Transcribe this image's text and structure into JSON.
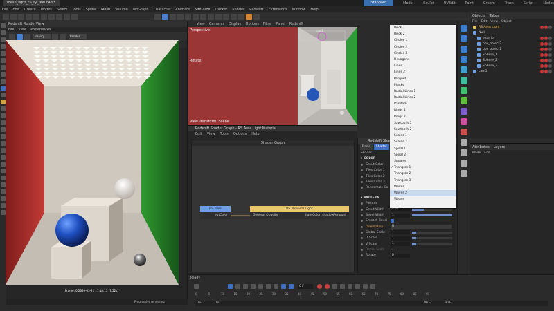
{
  "titlebar": {
    "tab": "mesh_light_cu_ty_real.c4d *",
    "layouts": [
      "Standard",
      "Model",
      "Sculpt",
      "UVEdit",
      "Paint",
      "Groom",
      "Track",
      "Script",
      "Nodes"
    ]
  },
  "menu": [
    "File",
    "Edit",
    "Create",
    "Modes",
    "Select",
    "Tools",
    "Spline",
    "Mesh",
    "Volume",
    "MoGraph",
    "Character",
    "Animate",
    "Simulate",
    "Tracker",
    "Render",
    "Redshift",
    "Extensions",
    "Window",
    "Help"
  ],
  "renderview": {
    "title": "Redshift RenderView",
    "menu": [
      "File",
      "View",
      "Preferences"
    ],
    "mode": "Beauty",
    "render_sel": "Render",
    "zoom": "96 %",
    "size": "Original Size",
    "frame_info": "Frame: 0  2020-03-21  17:18:13  (7.52s)",
    "status": "Progressive rendering"
  },
  "viewport": {
    "menu": [
      "View",
      "Cameras",
      "Display",
      "Options",
      "Filter",
      "Panel",
      "Redshift"
    ],
    "label": "Perspective",
    "mode": "Rotate",
    "bottom": "View Transform: Scene",
    "camera": "cam1"
  },
  "shader": {
    "title": "Redshift Shader Graph - RS Area Light Material",
    "menu": [
      "Edit",
      "View",
      "Tools",
      "Options",
      "Help"
    ],
    "graph_title": "Shader Graph",
    "node1": {
      "title": "RS Tiles",
      "port": "outColor"
    },
    "node2": {
      "title": "RS Physical Light",
      "in": "General Opacity",
      "out": "lightColor_shadowAmount"
    }
  },
  "attr": {
    "header": "Redshift Shader",
    "tabs": [
      "Basic",
      "Shader"
    ],
    "section_label": "Shader",
    "color_section": "COLOR",
    "color_rows": [
      "Grout Color",
      "Tiles Color 1",
      "Tiles Color 2",
      "Tiles Color 3",
      "Randomize Co"
    ],
    "pattern_section": "PATTERN",
    "pattern_label": "Pattern",
    "pattern_value": "Triangles 1",
    "grout_width_label": "Grout Width",
    "grout_width": "0.327",
    "bevel_width_label": "Bevel Width",
    "bevel_width": "1",
    "smooth_bevel_label": "Smooth Bevel",
    "orientation_label": "Orientation",
    "orientation": "U",
    "global_scale_label": "Global Scale",
    "global_scale": "1",
    "u_scale_label": "U Scale",
    "u_scale": "1",
    "v_scale_label": "V Scale",
    "v_scale": "1",
    "radial_scale_label": "Radial Scale",
    "rotate_label": "Rotate",
    "rotate": "0",
    "sliders": {
      "grout_width": 0.3,
      "bevel_width": 1,
      "global_scale": 0.1,
      "u_scale": 0.1,
      "v_scale": 0.1
    }
  },
  "dropdown": {
    "items": [
      "Brick 1",
      "Brick 2",
      "Circles 1",
      "Circles 2",
      "Circles 3",
      "Hexagons",
      "Lines 1",
      "Lines 2",
      "Parquet",
      "Planks",
      "Radial Lines 1",
      "Radial Lines 2",
      "Random",
      "Rings 1",
      "Rings 2",
      "Sawtooth 1",
      "Sawtooth 2",
      "Scales 1",
      "Scales 2",
      "Spiral 1",
      "Spiral 2",
      "Squares",
      "Triangles 1",
      "Triangles 2",
      "Triangles 3",
      "Waves 1",
      "Waves 2",
      "Weave"
    ],
    "checked": "Triangles 1",
    "hover": "Waves 2"
  },
  "objects": {
    "tabs": [
      "Objects",
      "Takes"
    ],
    "menu": [
      "File",
      "Edit",
      "View",
      "Object"
    ],
    "items": [
      {
        "name": "RS Area Light",
        "indent": 0,
        "sel": true
      },
      {
        "name": "Null",
        "indent": 0,
        "sel": false
      },
      {
        "name": "exterior",
        "indent": 1,
        "sel": false
      },
      {
        "name": "box_object2",
        "indent": 1,
        "sel": false
      },
      {
        "name": "box_object1",
        "indent": 1,
        "sel": false
      },
      {
        "name": "Sphere_1",
        "indent": 1,
        "sel": false
      },
      {
        "name": "Sphere_2",
        "indent": 1,
        "sel": false
      },
      {
        "name": "Sphere_3",
        "indent": 1,
        "sel": false
      },
      {
        "name": "cam1",
        "indent": 0,
        "sel": false
      }
    ]
  },
  "attrright": {
    "tabs": [
      "Attributes",
      "Layers"
    ],
    "menu": [
      "Mode",
      "Edit"
    ]
  },
  "timeline": {
    "status": "Ready",
    "frame": "0 F",
    "ruler": [
      "0",
      "5",
      "10",
      "15",
      "20",
      "25",
      "30",
      "35",
      "40",
      "45",
      "50",
      "55",
      "60",
      "65",
      "70",
      "75",
      "80",
      "85",
      "90"
    ],
    "start": "0 F",
    "start2": "0 F",
    "end": "90 F",
    "end2": "90 F"
  },
  "colors": {
    "accent": "#3f6fbf",
    "node_blue": "#6f9ee6",
    "node_yellow": "#e8c86a",
    "red_wall": "#b2302e",
    "green_wall": "#2f8a2e"
  }
}
